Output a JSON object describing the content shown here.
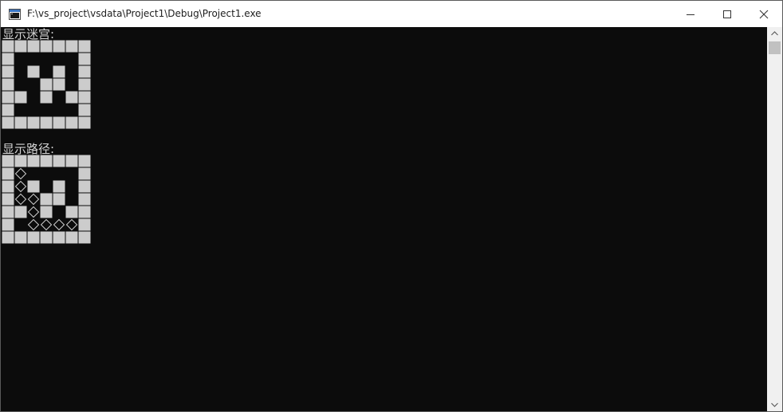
{
  "window": {
    "title": "F:\\vs_project\\vsdata\\Project1\\Debug\\Project1.exe"
  },
  "console": {
    "maze_label": "显示迷宫:",
    "path_label": "显示路径:",
    "maze_rows": [
      "WWWWWWW",
      "W.....W",
      "W.W.W.W",
      "W..WW.W",
      "WW.W.WW",
      "W.....W",
      "WWWWWWW"
    ],
    "path_rows": [
      "WWWWWWW",
      "WP....W",
      "WPW.W.W",
      "WPPWW.W",
      "WWPW.WW",
      "W.PPPPW",
      "WWWWWWW"
    ]
  },
  "colors": {
    "wall": "#cccccc",
    "background": "#0c0c0c",
    "path_mark": "#cccccc"
  },
  "icons": {
    "app": "console-app-icon",
    "minimize": "minimize-icon",
    "maximize": "maximize-icon",
    "close": "close-icon",
    "scroll_up": "chevron-up-icon",
    "scroll_down": "chevron-down-icon"
  }
}
